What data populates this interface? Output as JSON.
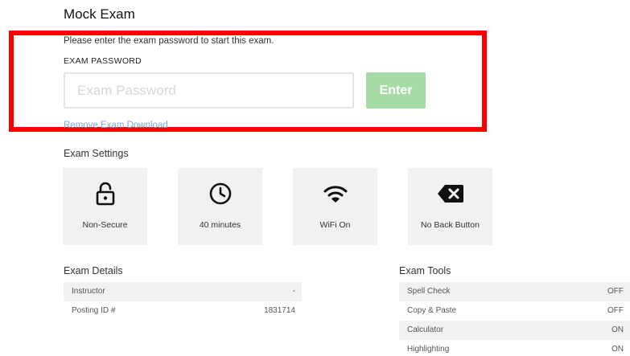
{
  "header": {
    "title": "Mock Exam"
  },
  "password_section": {
    "intro": "Please enter the exam password to start this exam.",
    "label": "EXAM PASSWORD",
    "input_value": "",
    "input_placeholder": "Exam Password",
    "enter_label": "Enter",
    "remove_link": "Remove Exam Download"
  },
  "settings": {
    "heading": "Exam Settings",
    "cards": [
      {
        "label": "Non-Secure",
        "icon": "unlocked-padlock-icon"
      },
      {
        "label": "40 minutes",
        "icon": "clock-icon"
      },
      {
        "label": "WiFi On",
        "icon": "wifi-icon"
      },
      {
        "label": "No Back Button",
        "icon": "backspace-x-icon"
      }
    ]
  },
  "details": {
    "heading": "Exam Details",
    "rows": [
      {
        "key": "Instructor",
        "value": "-"
      },
      {
        "key": "Posting ID #",
        "value": "1831714"
      }
    ]
  },
  "tools": {
    "heading": "Exam Tools",
    "rows": [
      {
        "key": "Spell Check",
        "value": "OFF"
      },
      {
        "key": "Copy & Paste",
        "value": "OFF"
      },
      {
        "key": "Calculator",
        "value": "ON"
      },
      {
        "key": "Highlighting",
        "value": "ON"
      }
    ]
  },
  "colors": {
    "highlight_border": "#ff0000",
    "enter_button": "#a6dba6",
    "link": "#7aa9dc",
    "card_bg": "#f0f1f3"
  }
}
